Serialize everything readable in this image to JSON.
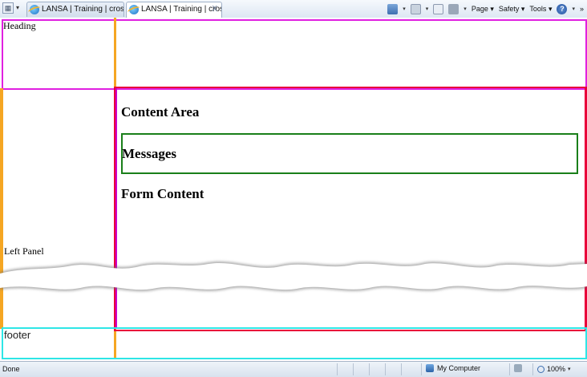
{
  "browser": {
    "tabs": [
      {
        "label": "LANSA | Training | cross bro..."
      },
      {
        "label": "LANSA | Training | cross ..."
      }
    ],
    "tab_close_glyph": "X",
    "command_bar": {
      "page_label": "Page",
      "safety_label": "Safety",
      "tools_label": "Tools",
      "overflow_glyph": "»"
    }
  },
  "page": {
    "heading_label": "Heading",
    "left_panel_label": "Left Panel",
    "content_area_title": "Content Area",
    "messages_title": "Messages",
    "form_content_title": "Form Content",
    "footer_label": "footer",
    "colors": {
      "heading_border": "#e020e0",
      "left_panel_border": "#f5a623",
      "content_border": "#e8003a",
      "messages_border": "#1a7f1a",
      "footer_border": "#2ee6e6"
    }
  },
  "statusbar": {
    "status": "Done",
    "zone": "My Computer",
    "zoom": "100%"
  }
}
